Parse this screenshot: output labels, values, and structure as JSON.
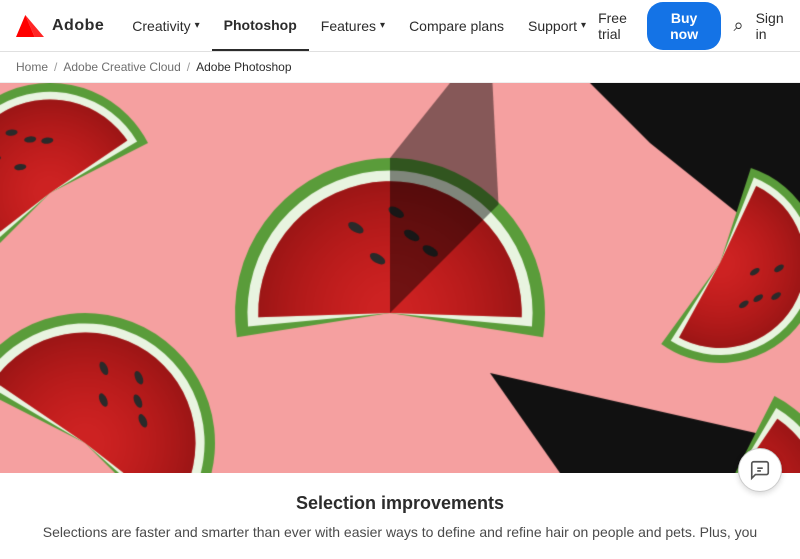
{
  "nav": {
    "adobe_logo_text": "Adobe",
    "items": [
      {
        "label": "Creativity",
        "hasChevron": true,
        "active": false,
        "key": "creativity"
      },
      {
        "label": "Photoshop",
        "hasChevron": false,
        "active": true,
        "key": "photoshop"
      },
      {
        "label": "Features",
        "hasChevron": true,
        "active": false,
        "key": "features"
      },
      {
        "label": "Compare plans",
        "hasChevron": false,
        "active": false,
        "key": "compare"
      },
      {
        "label": "Support",
        "hasChevron": true,
        "active": false,
        "key": "support"
      }
    ],
    "free_trial_label": "Free trial",
    "buy_now_label": "Buy now",
    "sign_in_label": "Sign in"
  },
  "breadcrumb": {
    "home": "Home",
    "creative_cloud": "Adobe Creative Cloud",
    "current": "Adobe Photoshop"
  },
  "hero": {
    "alt": "Watermelon slices on pink background"
  },
  "content": {
    "title": "Selection improvements",
    "body": "Selections are faster and smarter than ever with easier ways to define and refine hair on people and pets. Plus, you"
  }
}
